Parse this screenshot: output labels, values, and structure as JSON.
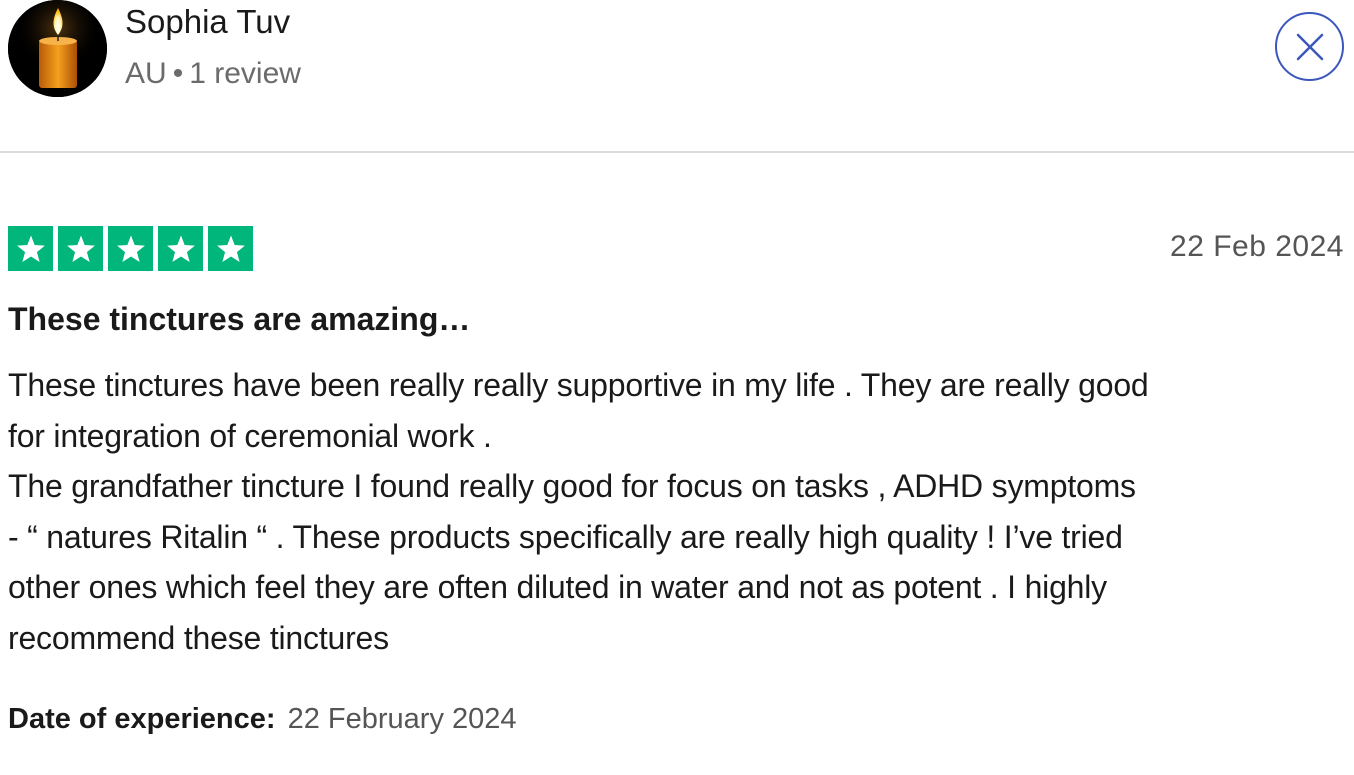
{
  "reviewer": {
    "name": "Sophia Tuv",
    "country": "AU",
    "separator": "•",
    "review_count": "1 review",
    "avatar_icon": "candle-icon"
  },
  "close_icon": "close-icon",
  "review": {
    "rating": 5,
    "rating_max": 5,
    "star_color": "#00b67a",
    "date": "22 Feb 2024",
    "title": "These tinctures are amazing…",
    "body": "These tinctures have been really really supportive in my life . They are really good\nfor integration of ceremonial work .\nThe grandfather tincture I found really good for focus on tasks , ADHD symptoms\n- “ natures Ritalin “ . These products specifically are really high quality ! I’ve tried\nother ones which feel they are often diluted in water and not as potent . I highly\nrecommend these tinctures",
    "experience_label": "Date of experience:",
    "experience_date": "22 February 2024"
  },
  "colors": {
    "accent": "#3c57bc",
    "trustpilot_green": "#00b67a"
  }
}
